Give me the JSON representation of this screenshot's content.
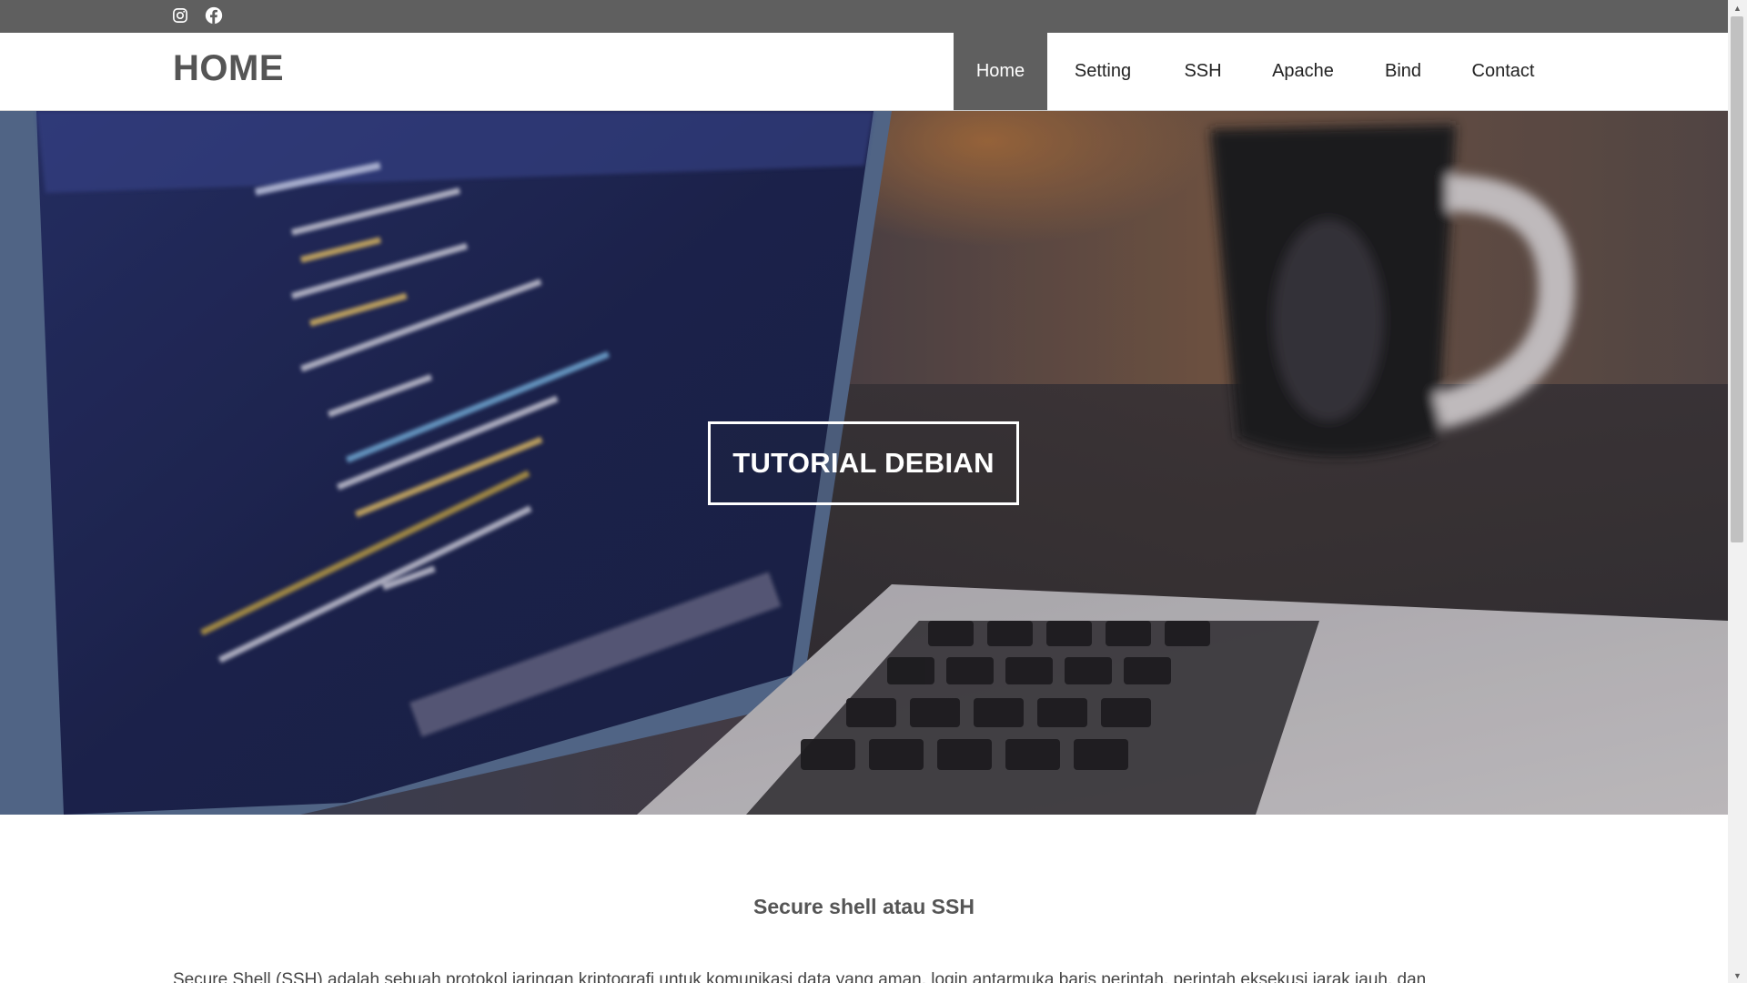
{
  "social": {
    "icons": [
      "instagram-icon",
      "facebook-icon"
    ]
  },
  "header": {
    "brand": "HOME",
    "nav": [
      {
        "label": "Home",
        "active": true
      },
      {
        "label": "Setting"
      },
      {
        "label": "SSH"
      },
      {
        "label": "Apache"
      },
      {
        "label": "Bind"
      },
      {
        "label": "Contact"
      }
    ]
  },
  "hero": {
    "title": "TUTORIAL DEBIAN"
  },
  "content": {
    "section_title": "Secure shell atau SSH",
    "paragraph": "Secure Shell (SSH) adalah sebuah protokol jaringan kriptografi untuk komunikasi data yang aman, login antarmuka baris perintah, perintah eksekusi jarak jauh, dan"
  },
  "colors": {
    "topbar": "#5f5f5f",
    "nav_active": "#5f5f5f",
    "brand_text": "#555555"
  }
}
